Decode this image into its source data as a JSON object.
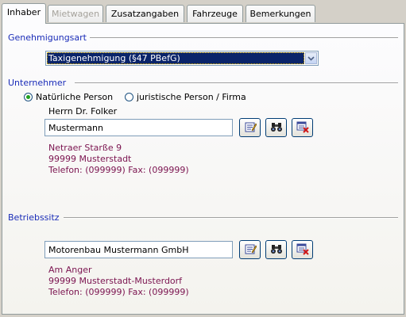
{
  "tabs": [
    {
      "label": "Inhaber",
      "state": "active"
    },
    {
      "label": "Mietwagen",
      "state": "disabled"
    },
    {
      "label": "Zusatzangaben",
      "state": "normal"
    },
    {
      "label": "Fahrzeuge",
      "state": "normal"
    },
    {
      "label": "Bemerkungen",
      "state": "normal"
    }
  ],
  "genehmigung": {
    "title": "Genehmigungsart",
    "selected": "Taxigenehmigung (§47 PBefG)"
  },
  "unternehmer": {
    "title": "Unternehmer",
    "radio_natural": "Natürliche Person",
    "radio_legal": "juristische Person / Firma",
    "selected_radio": "natural",
    "salutation": "Herrn Dr. Folker",
    "name": "Mustermann",
    "street": "Netraer Starße 9",
    "city": "99999 Musterstadt",
    "phone": "Telefon: (099999) Fax: (099999)"
  },
  "betriebssitz": {
    "title": "Betriebssitz",
    "name": "Motorenbau Mustermann GmbH",
    "street": "Am Anger",
    "city": "99999 Musterstadt-Musterdorf",
    "phone": "Telefon: (099999) Fax: (099999)"
  },
  "icons": {
    "edit": "edit-icon",
    "search": "binoculars-icon",
    "delete": "delete-record-icon"
  },
  "colors": {
    "section_title": "#1a2cb8",
    "address_text": "#7b1450",
    "selection_bg": "#0a246a"
  }
}
